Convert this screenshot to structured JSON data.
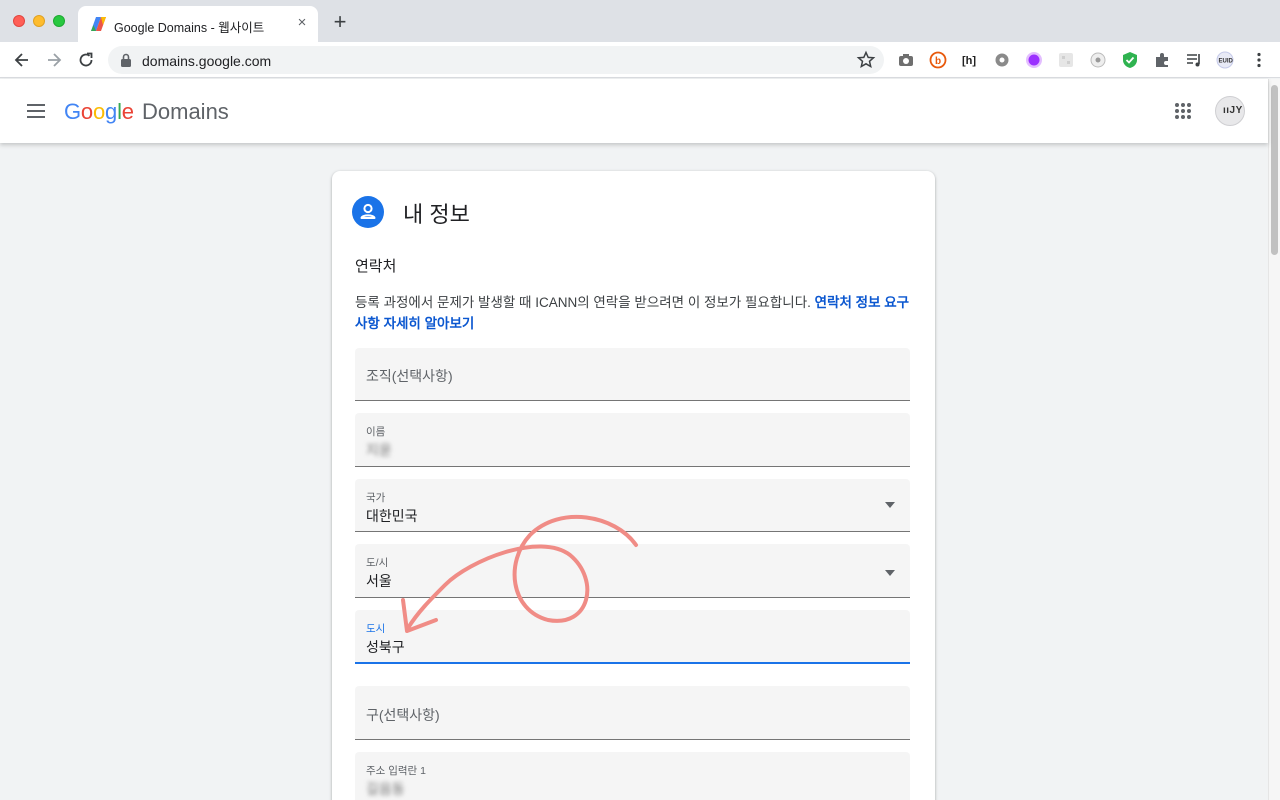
{
  "browser": {
    "tab_title": "Google Domains - 웹사이트",
    "url": "domains.google.com",
    "tab_close": "×",
    "new_tab": "+"
  },
  "appbar": {
    "logo_google": "Google",
    "logo_domains": "Domains",
    "avatar_text": "ııJY"
  },
  "card": {
    "title": "내 정보",
    "section": "연락처",
    "description": "등록 과정에서 문제가 발생할 때 ICANN의 연락을 받으려면 이 정보가 필요합니다.",
    "learn_more_link": "연락처 정보 요구사항 자세히 알아보기",
    "fields": {
      "organization": {
        "placeholder": "조직(선택사항)"
      },
      "name": {
        "label": "이름",
        "value": "지윤"
      },
      "country": {
        "label": "국가",
        "value": "대한민국"
      },
      "province": {
        "label": "도/시",
        "value": "서울"
      },
      "city": {
        "label": "도시",
        "value": "성북구"
      },
      "district": {
        "placeholder": "구(선택사항)"
      },
      "address1": {
        "label": "주소 입력란 1",
        "value": "길음동"
      }
    }
  },
  "colors": {
    "accent": "#1a73e8",
    "link": "#0b57d0",
    "annotation": "#f08c86"
  }
}
